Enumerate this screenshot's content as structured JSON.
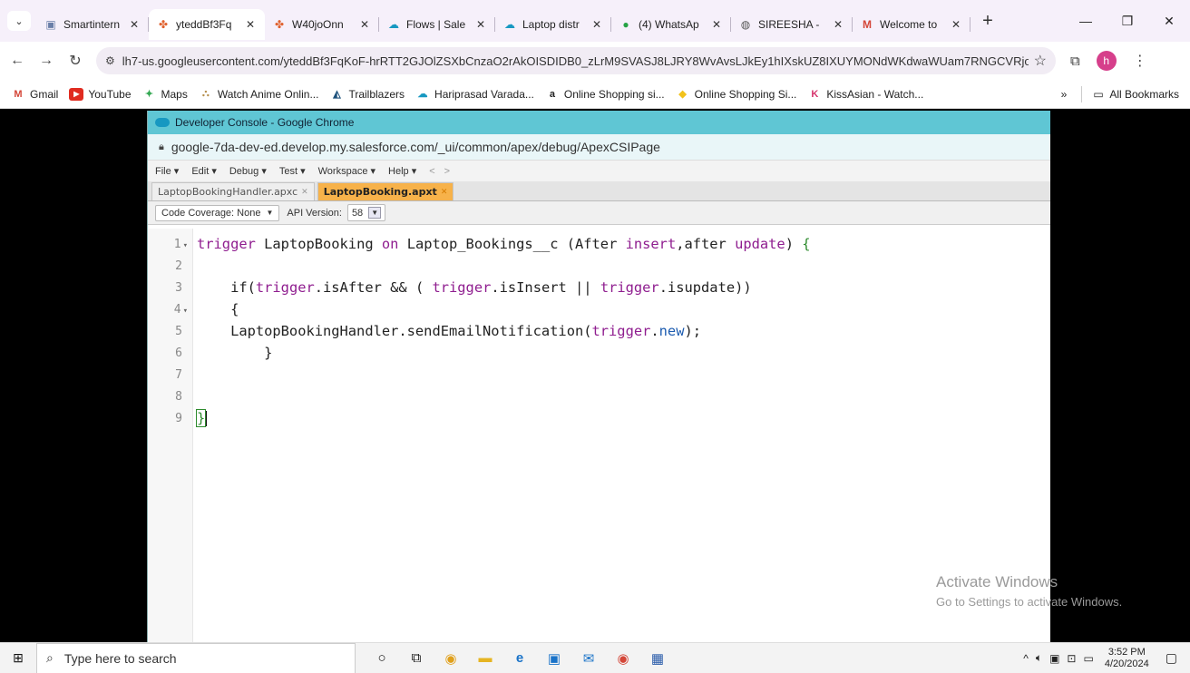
{
  "browser": {
    "tabs": [
      {
        "title": "Smartintern",
        "icon": "smartinternz-icon",
        "active": false
      },
      {
        "title": "yteddBf3Fq",
        "icon": "pinwheel-icon",
        "active": true
      },
      {
        "title": "W40joOnn",
        "icon": "pinwheel-icon",
        "active": false
      },
      {
        "title": "Flows | Sale",
        "icon": "salesforce-cloud-icon",
        "active": false
      },
      {
        "title": "Laptop distr",
        "icon": "salesforce-cloud-icon",
        "active": false
      },
      {
        "title": "(4) WhatsAp",
        "icon": "whatsapp-icon",
        "active": false
      },
      {
        "title": "SIREESHA -",
        "icon": "globe-icon",
        "active": false
      },
      {
        "title": "Welcome to",
        "icon": "gmail-icon",
        "active": false
      }
    ],
    "new_tab_label": "+",
    "url": "lh7-us.googleusercontent.com/yteddBf3FqKoF-hrRTT2GJOlZSXbCnzaO2rAkOISDIDB0_zLrM9SVASJ8LJRY8WvAvsLJkEy1hIXskUZ8IXUYMONdWKdwaWUam7RNGCVRjo...",
    "profile_initial": "h",
    "bookmarks": [
      {
        "label": "Gmail",
        "icon": "gmail-icon"
      },
      {
        "label": "YouTube",
        "icon": "youtube-icon"
      },
      {
        "label": "Maps",
        "icon": "maps-icon"
      },
      {
        "label": "Watch Anime Onlin...",
        "icon": "anime-icon"
      },
      {
        "label": "Trailblazers",
        "icon": "trailblazers-icon"
      },
      {
        "label": "Hariprasad Varada...",
        "icon": "salesforce-cloud-icon"
      },
      {
        "label": "Online Shopping si...",
        "icon": "amazon-icon"
      },
      {
        "label": "Online Shopping Si...",
        "icon": "flipkart-icon"
      },
      {
        "label": "KissAsian - Watch...",
        "icon": "kissasian-icon"
      }
    ],
    "bookmarks_overflow": "»",
    "all_bookmarks": "All Bookmarks"
  },
  "devconsole": {
    "window_title": "Developer Console - Google Chrome",
    "url": "google-7da-dev-ed.develop.my.salesforce.com/_ui/common/apex/debug/ApexCSIPage",
    "menu": [
      "File ▾",
      "Edit ▾",
      "Debug ▾",
      "Test ▾",
      "Workspace ▾",
      "Help ▾"
    ],
    "nav_back": "<",
    "nav_forward": ">",
    "tabs": [
      {
        "label": "LaptopBookingHandler.apxc",
        "active": false
      },
      {
        "label": "LaptopBooking.apxt",
        "active": true
      }
    ],
    "code_coverage": "Code Coverage: None",
    "api_label": "API Version:",
    "api_version": "58"
  },
  "code": {
    "line_numbers": [
      "1",
      "2",
      "3",
      "4",
      "5",
      "6",
      "7",
      "8",
      "9"
    ],
    "lines": {
      "l1": {
        "t1": "trigger",
        "t2": " LaptopBooking ",
        "t3": "on",
        "t4": " Laptop_Bookings__c (After ",
        "t5": "insert",
        "t6": ",after ",
        "t7": "update",
        "t8": ") ",
        "t9": "{"
      },
      "l3": {
        "t1": "    if(",
        "t2": "trigger",
        "t3": ".isAfter && ( ",
        "t4": "trigger",
        "t5": ".isInsert || ",
        "t6": "trigger",
        "t7": ".isupdate))"
      },
      "l4": "    {",
      "l5": {
        "t1": "    LaptopBookingHandler.sendEmailNotification(",
        "t2": "trigger",
        "t3": ".",
        "t4": "new",
        "t5": ");"
      },
      "l6": "        }",
      "l9": "}"
    }
  },
  "watermark": {
    "line1": "Activate Windows",
    "line2": "Go to Settings to activate Windows."
  },
  "taskbar": {
    "search_placeholder": "Type here to search",
    "time": "3:52 PM",
    "date": "4/20/2024"
  }
}
